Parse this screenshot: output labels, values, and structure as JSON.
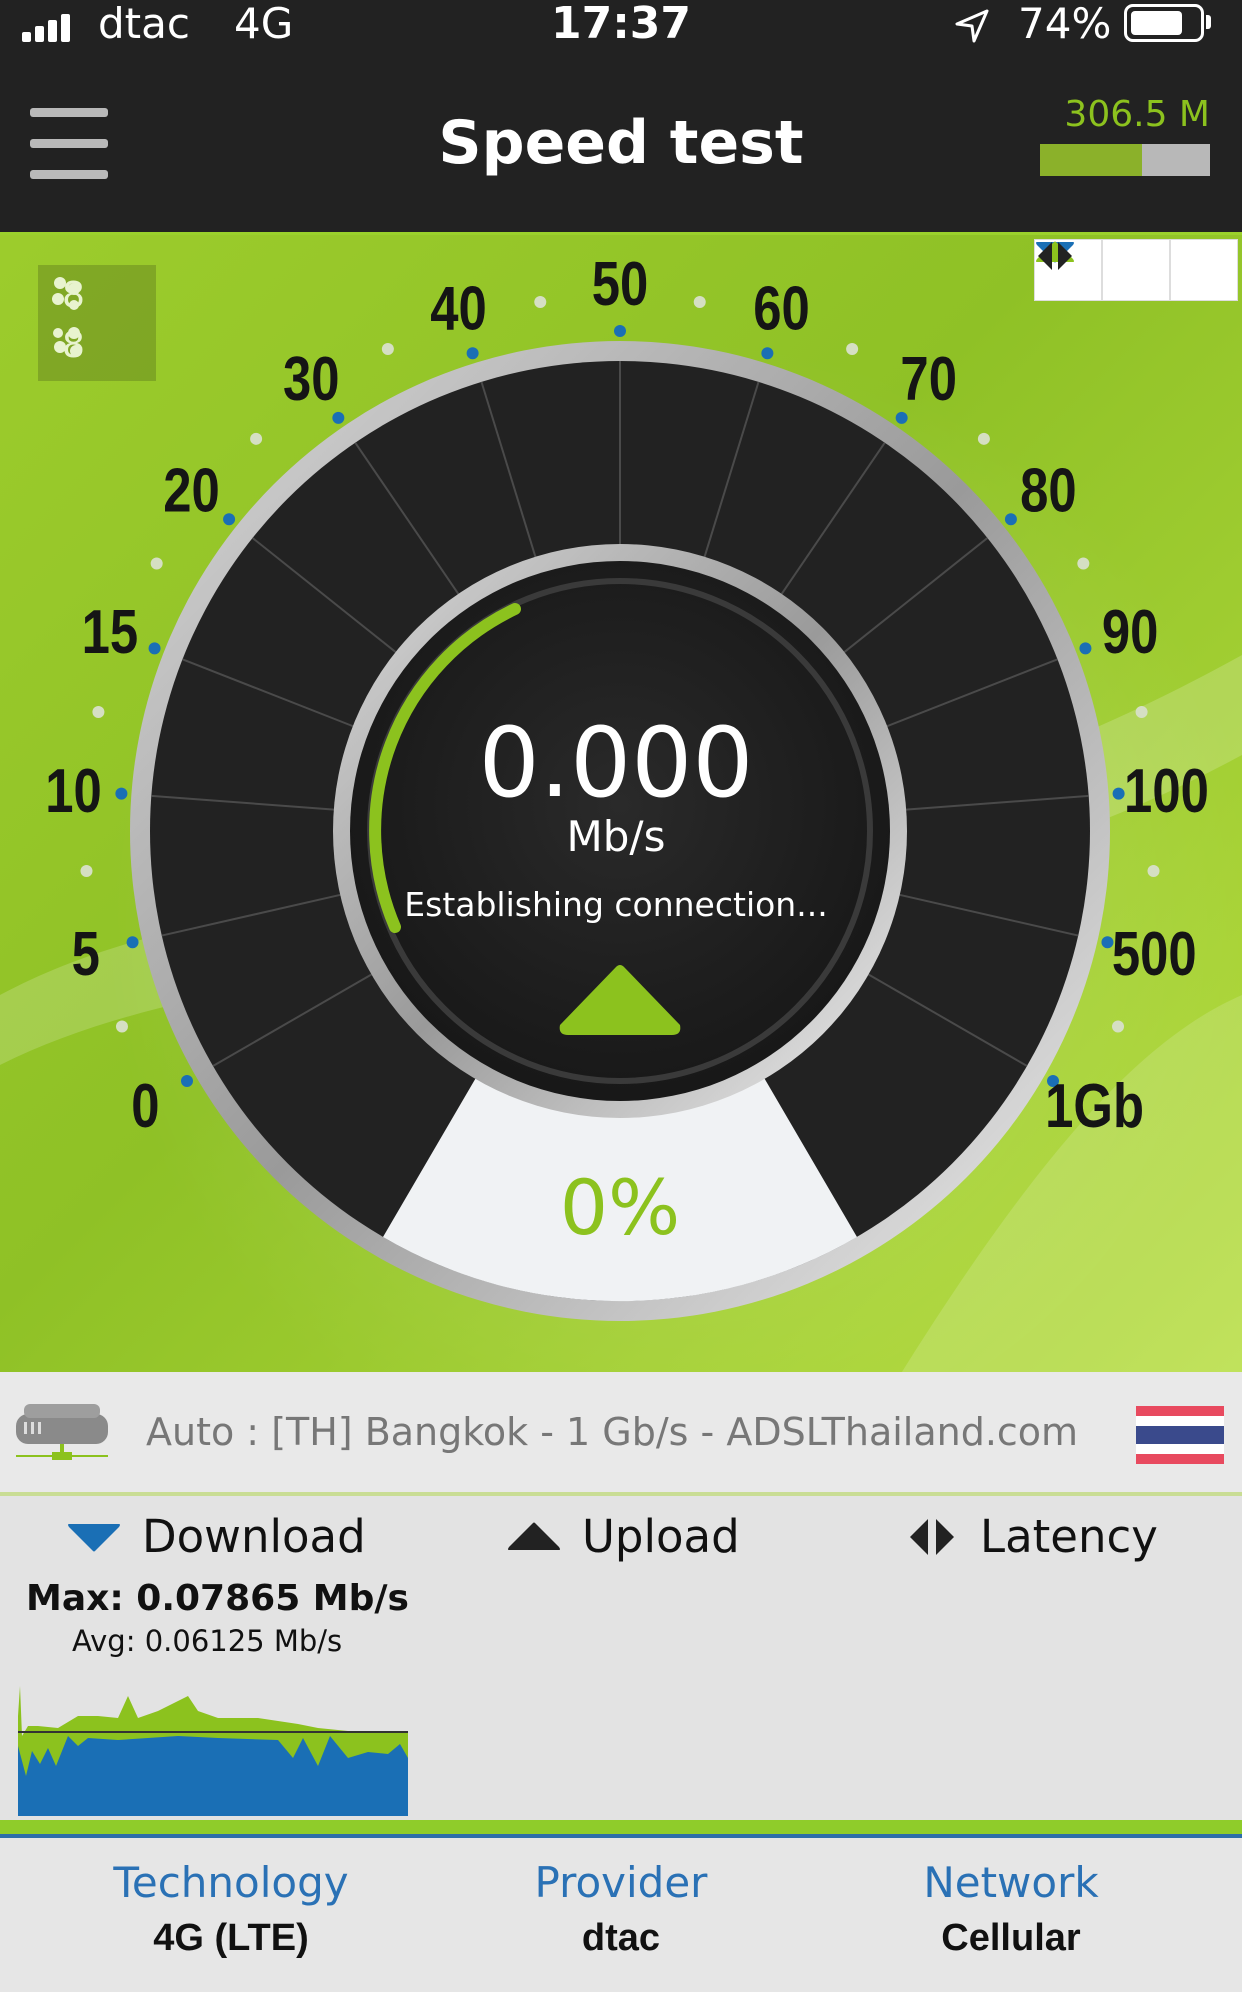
{
  "status_bar": {
    "carrier": "dtac",
    "network": "4G",
    "time": "17:37",
    "battery": "74%",
    "battery_level": 0.74,
    "signal_bars": 4
  },
  "header": {
    "title": "Speed test",
    "data_used": "306.5 M",
    "data_used_fraction": 0.6
  },
  "gauge": {
    "connections_download": "8",
    "connections_upload": "8",
    "scale_labels": [
      "0",
      "5",
      "10",
      "15",
      "20",
      "30",
      "40",
      "50",
      "60",
      "70",
      "80",
      "90",
      "100",
      "500",
      "1Gb"
    ],
    "speed_value": "0.000",
    "speed_unit": "Mb/s",
    "status": "Establishing connection...",
    "progress": "0%",
    "progress_value": 0,
    "mode_buttons": [
      "download-mode",
      "upload-mode",
      "latency-mode"
    ]
  },
  "server": {
    "text": "Auto : [TH] Bangkok - 1 Gb/s - ADSLThailand.com",
    "flag_colors": [
      "#e84a5f",
      "#ffffff",
      "#3a4a8c",
      "#ffffff",
      "#e84a5f"
    ]
  },
  "results": {
    "download_label": "Download",
    "upload_label": "Upload",
    "latency_label": "Latency",
    "download_max": "Max: 0.07865 Mb/s",
    "download_avg": "Avg: 0.06125 Mb/s"
  },
  "info": {
    "technology_label": "Technology",
    "technology_value": "4G (LTE)",
    "provider_label": "Provider",
    "provider_value": "dtac",
    "network_label": "Network",
    "network_value": "Cellular"
  },
  "colors": {
    "accent_green": "#8cc21e",
    "download_blue": "#1a6fb5",
    "dark": "#222222"
  }
}
